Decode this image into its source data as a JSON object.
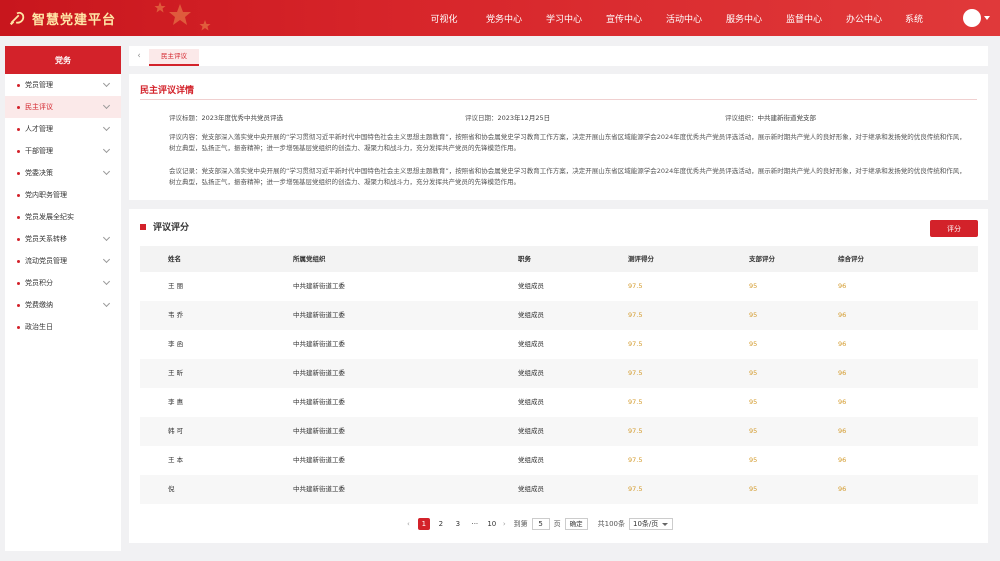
{
  "header": {
    "title": "智慧党建平台",
    "nav": [
      "可视化",
      "党务中心",
      "学习中心",
      "宣传中心",
      "活动中心",
      "服务中心",
      "监督中心",
      "办公中心",
      "系统"
    ]
  },
  "sidebar": {
    "title": "党务",
    "items": [
      {
        "label": "党员管理",
        "chevron": true
      },
      {
        "label": "民主评议",
        "chevron": true,
        "active": true
      },
      {
        "label": "人才管理",
        "chevron": true
      },
      {
        "label": "干部管理",
        "chevron": true
      },
      {
        "label": "党委决策",
        "chevron": true
      },
      {
        "label": "党内职务管理",
        "chevron": false
      },
      {
        "label": "党员发展全纪实",
        "chevron": false
      },
      {
        "label": "党员关系转移",
        "chevron": true
      },
      {
        "label": "流动党员管理",
        "chevron": true
      },
      {
        "label": "党员积分",
        "chevron": true
      },
      {
        "label": "党费缴纳",
        "chevron": true
      },
      {
        "label": "政治生日",
        "chevron": false
      }
    ]
  },
  "tabbar": {
    "back": "‹",
    "active_tab": "民主评议"
  },
  "detail": {
    "title": "民主评议详情",
    "subject_label": "评议标题：",
    "subject_value": "2023年度优秀中共党员评选",
    "date_label": "评议日期：",
    "date_value": "2023年12月25日",
    "org_label": "评议组织：",
    "org_value": "中共建新街道党支部",
    "content_label": "评议内容：",
    "content_value": "党支部深入落实党中央开展的“学习贯彻习近平新时代中国特色社会主义思想主题教育”，按照省和协会属党史学习教育工作方案，决定开展山东省区域能源学会2024年度优秀共产党员评选活动，展示新时期共产党人的良好形象，对于继承和发扬党的优良传统和作风，树立典型，弘扬正气，振奋精神；进一步增强基层党组织的创造力、凝聚力和战斗力，充分发挥共产党员的先锋模范作用。",
    "record_label": "会议记录：",
    "record_value": "党支部深入落实党中央开展的“学习贯彻习近平新时代中国特色社会主义思想主题教育”，按照省和协会属党史学习教育工作方案，决定开展山东省区域能源学会2024年度优秀共产党员评选活动，展示新时期共产党人的良好形象，对于继承和发扬党的优良传统和作风，树立典型，弘扬正气，振奋精神；进一步增强基层党组织的创造力、凝聚力和战斗力，充分发挥共产党员的先锋模范作用。"
  },
  "score": {
    "title": "评议评分",
    "button": "评分",
    "columns": [
      "姓名",
      "所属党组织",
      "职务",
      "测评得分",
      "支部评分",
      "综合评分"
    ],
    "rows": [
      [
        "王  丽",
        "中共建新街道工委",
        "党组成员",
        "97.5",
        "95",
        "96"
      ],
      [
        "韦  乔",
        "中共建新街道工委",
        "党组成员",
        "97.5",
        "95",
        "96"
      ],
      [
        "李  函",
        "中共建新街道工委",
        "党组成员",
        "97.5",
        "95",
        "96"
      ],
      [
        "王  昕",
        "中共建新街道工委",
        "党组成员",
        "97.5",
        "95",
        "96"
      ],
      [
        "李  惠",
        "中共建新街道工委",
        "党组成员",
        "97.5",
        "95",
        "96"
      ],
      [
        "韩  可",
        "中共建新街道工委",
        "党组成员",
        "97.5",
        "95",
        "96"
      ],
      [
        "王  本",
        "中共建新街道工委",
        "党组成员",
        "97.5",
        "95",
        "96"
      ],
      [
        "倪",
        "中共建新街道工委",
        "党组成员",
        "97.5",
        "95",
        "96"
      ]
    ]
  },
  "pagination": {
    "prev": "‹",
    "pages": [
      "1",
      "2",
      "3",
      "···",
      "10"
    ],
    "next": "›",
    "goto_label": "到第",
    "goto_value": "5",
    "page_unit": "页",
    "confirm": "确定",
    "total": "共100条",
    "page_size": "10条/页"
  }
}
